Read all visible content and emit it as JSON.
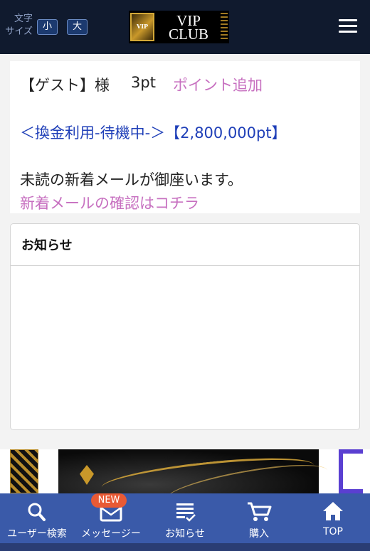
{
  "header": {
    "font_size_label_line1": "文字",
    "font_size_label_line2": "サイズ",
    "small_label": "小",
    "large_label": "大",
    "logo_line1": "VIP",
    "logo_line2": "CLUB",
    "logo_emblem": "VIP",
    "menu_icon": "hamburger-menu-icon"
  },
  "account": {
    "user_label": "【ゲスト】様",
    "points": "3pt",
    "add_points_link": "ポイント追加",
    "exchange_status": "＜換金利用-待機中-＞【2,800,000pt】",
    "unread_message": "未読の新着メールが御座います。",
    "check_mail_link": "新着メールの確認はコチラ"
  },
  "notice": {
    "title": "お知らせ"
  },
  "nav": {
    "items": [
      {
        "label": "ユーザー検索",
        "icon": "search-icon"
      },
      {
        "label": "メッセージー",
        "icon": "message-icon"
      },
      {
        "label": "お知らせ",
        "icon": "notice-list-icon"
      },
      {
        "label": "購入",
        "icon": "cart-icon"
      },
      {
        "label": "TOP",
        "icon": "home-icon"
      }
    ],
    "new_badge": "NEW"
  },
  "colors": {
    "header_bg": "#101a2e",
    "nav_bg": "#3a5aa9",
    "link_pink": "#c770c0",
    "status_blue": "#1f3fb8",
    "badge_orange": "#e85a35"
  }
}
